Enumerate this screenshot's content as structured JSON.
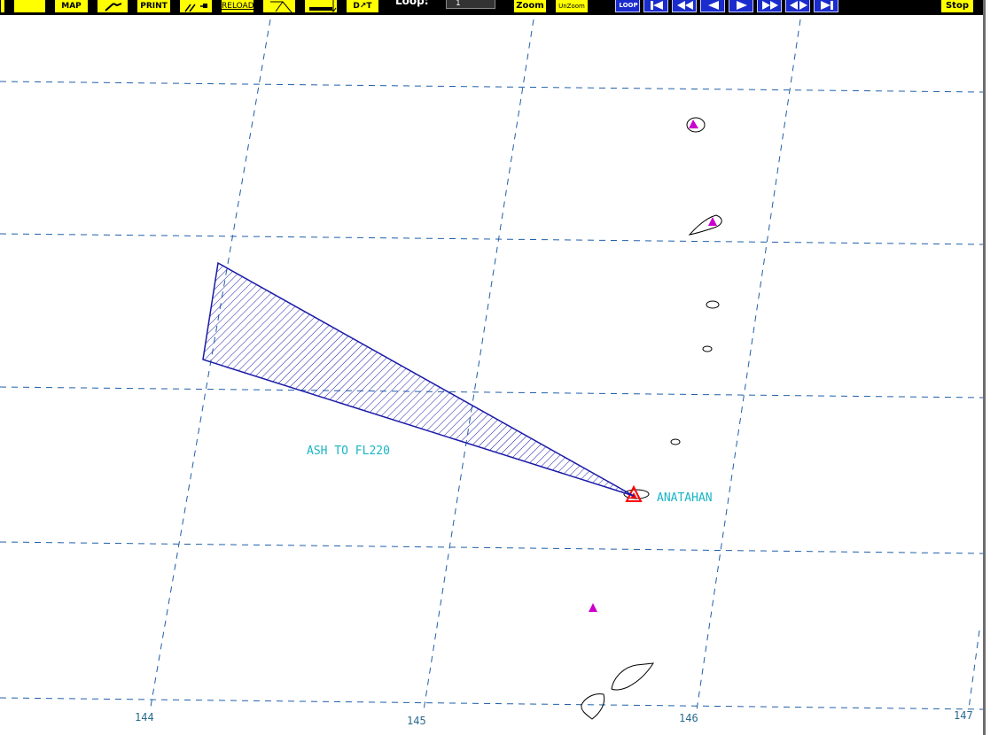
{
  "toolbar": {
    "buttons": {
      "map": "MAP",
      "print": "PRINT",
      "reload": "RELOAD",
      "draw_text": "D↗T",
      "zoom": "Zoom",
      "unzoom": "UnZoom",
      "loop": "LOOP",
      "stop": "Stop"
    },
    "loop_label": "Loop:",
    "loop_value": "1"
  },
  "map": {
    "longitude_labels": [
      "144",
      "145",
      "146",
      "147"
    ],
    "ash_label": "ASH TO FL220",
    "volcano_label": "ANATAHAN"
  },
  "colors": {
    "toolbar_bg": "#000000",
    "button_yellow": "#ffff00",
    "loop_blue": "#1a2ccc",
    "grid": "#1f5fa8",
    "ash_outline": "#1a1aa8",
    "label_cyan": "#19b5c4",
    "volcano_magenta": "#cc00cc",
    "volcano_red": "#ff0000"
  },
  "icons": {
    "blank": "blank-icon",
    "pen": "pen-icon",
    "arrows": "arrows-icon",
    "curve": "curve-icon",
    "measure": "measure-icon",
    "first": "first-frame-icon",
    "rewind": "rewind-icon",
    "back": "step-back-icon",
    "forward": "step-forward-icon",
    "fast_forward": "fast-forward-icon",
    "bounce": "bounce-icon",
    "last": "last-frame-icon"
  }
}
